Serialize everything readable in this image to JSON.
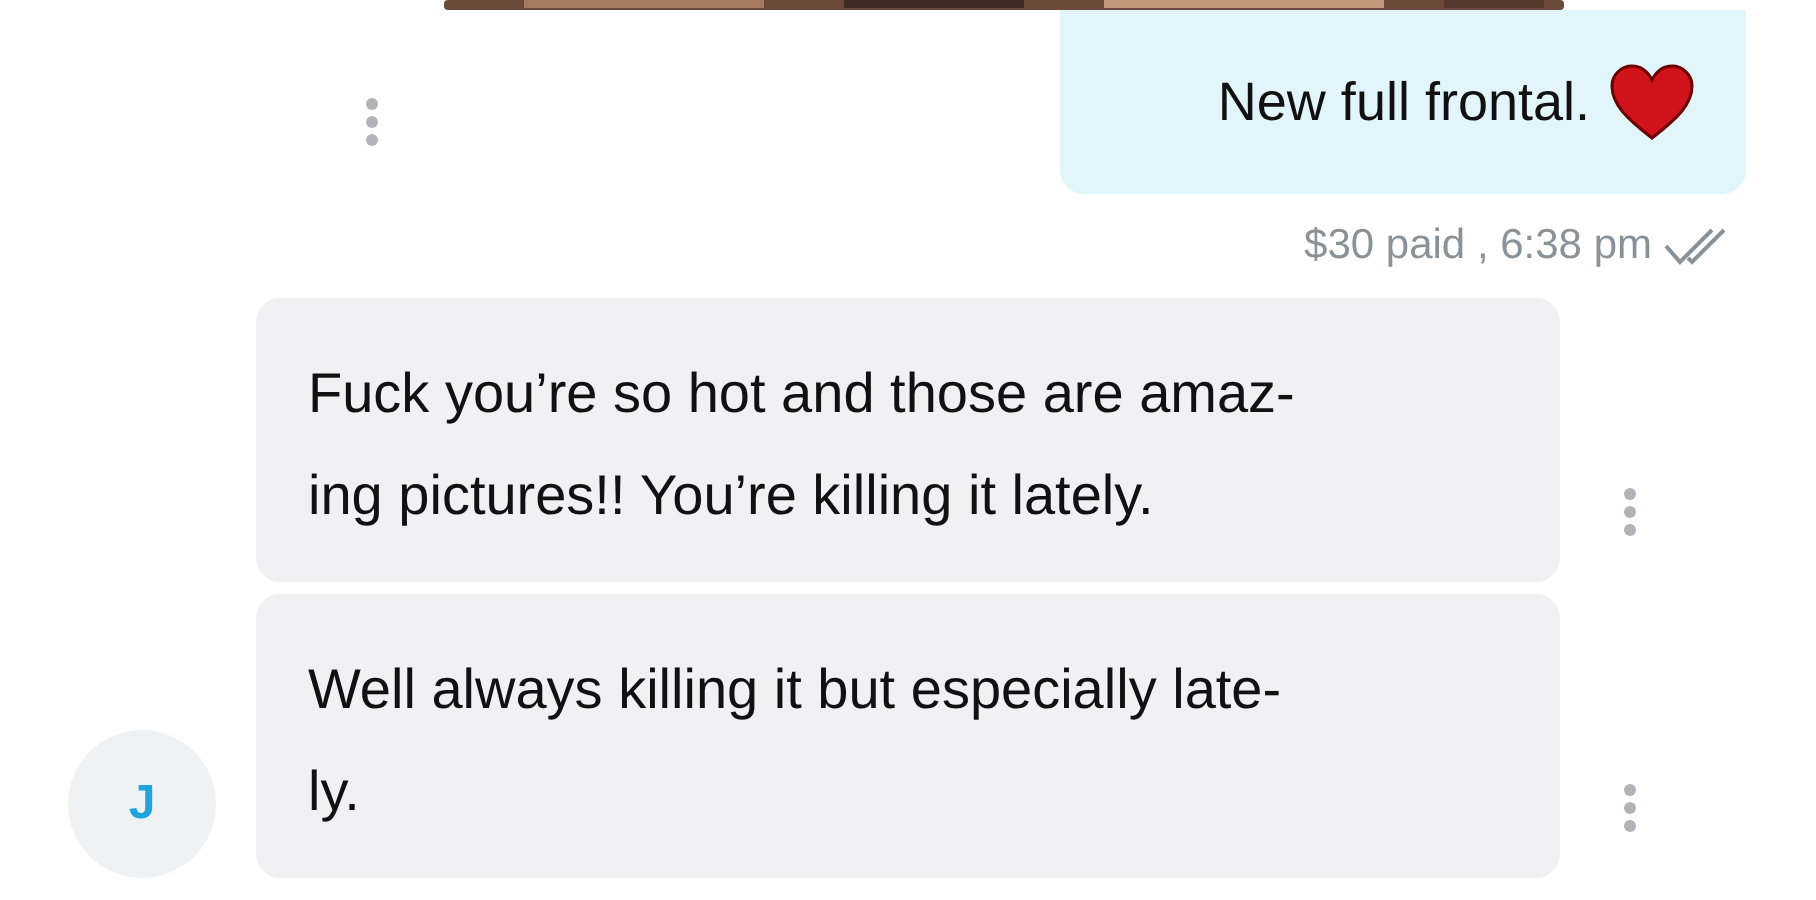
{
  "outgoing": {
    "lines": [
      "New full frontal."
    ],
    "heart": true
  },
  "meta": {
    "text": "$30 paid , 6:38 pm",
    "read": true
  },
  "incoming": [
    {
      "lines": [
        "Fuck you’re so hot and those are amaz-",
        "ing pictures!! You’re killing it lately."
      ],
      "avatar": false
    },
    {
      "lines": [
        "Well always killing it but especially late-",
        "ly."
      ],
      "avatar": true
    }
  ],
  "avatar": {
    "initial": "J"
  }
}
